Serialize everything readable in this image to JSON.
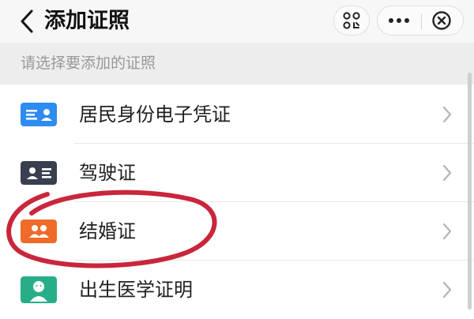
{
  "header": {
    "title": "添加证照",
    "back_icon": "chevron-left-icon",
    "qr_icon": "mini-program-code-icon",
    "more_icon": "more-dots-icon",
    "close_icon": "close-circle-icon"
  },
  "section": {
    "label": "请选择要添加的证照"
  },
  "items": [
    {
      "label": "居民身份电子凭证",
      "icon": "id-card-icon",
      "color": "#2e8bf0"
    },
    {
      "label": "驾驶证",
      "icon": "driver-license-icon",
      "color": "#3a3f4f"
    },
    {
      "label": "结婚证",
      "icon": "couple-icon",
      "color": "#f06a2a"
    },
    {
      "label": "出生医学证明",
      "icon": "baby-icon",
      "color": "#27ae88"
    }
  ],
  "annotation": {
    "color": "#c4142a"
  }
}
